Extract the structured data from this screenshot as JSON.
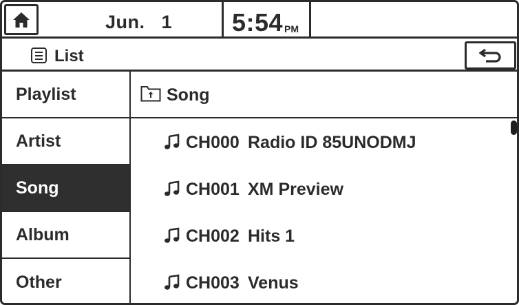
{
  "status_bar": {
    "date": "Jun.   1",
    "time": "5:54",
    "ampm": "PM"
  },
  "title_bar": {
    "title": "List",
    "icon": "list-icon",
    "back_icon": "back-arrow-icon"
  },
  "menu": {
    "items": [
      {
        "label": "Playlist",
        "active": false
      },
      {
        "label": "Artist",
        "active": false
      },
      {
        "label": "Song",
        "active": true
      },
      {
        "label": "Album",
        "active": false
      },
      {
        "label": "Other",
        "active": false
      }
    ]
  },
  "content": {
    "header": "Song",
    "header_icon": "folder-up-icon",
    "songs": [
      {
        "channel": "CH000",
        "name": "Radio ID 85UNODMJ"
      },
      {
        "channel": "CH001",
        "name": "XM Preview"
      },
      {
        "channel": "CH002",
        "name": "Hits 1"
      },
      {
        "channel": "CH003",
        "name": "Venus"
      }
    ]
  },
  "colors": {
    "ink": "#2b2b2b",
    "active_bg": "#2f2f2f",
    "active_text": "#ffffff",
    "background": "#ffffff"
  }
}
